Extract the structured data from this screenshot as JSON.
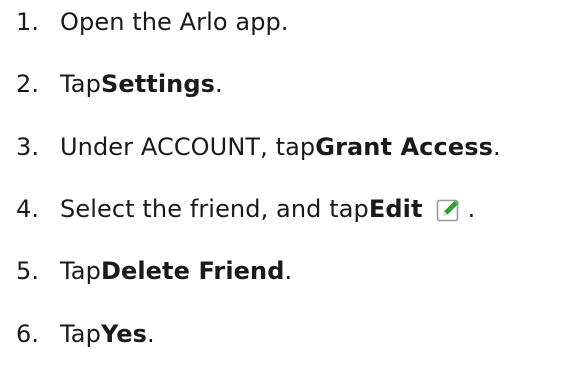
{
  "steps": [
    {
      "number": "1.",
      "pre": "Open the Arlo app.",
      "bold": "",
      "post": ""
    },
    {
      "number": "2.",
      "pre": "Tap ",
      "bold": "Settings",
      "post": "."
    },
    {
      "number": "3.",
      "pre": "Under ACCOUNT, tap ",
      "bold": "Grant Access",
      "post": "."
    },
    {
      "number": "4.",
      "pre": "Select the friend, and tap ",
      "bold": "Edit",
      "post": "."
    },
    {
      "number": "5.",
      "pre": "Tap ",
      "bold": "Delete Friend",
      "post": "."
    },
    {
      "number": "6.",
      "pre": "Tap ",
      "bold": "Yes",
      "post": "."
    }
  ],
  "icons": {
    "edit": "edit-pencil-icon"
  },
  "colors": {
    "text": "#1a1a1a",
    "icon_border": "#9a9a9a",
    "icon_pencil": "#2e9e3e"
  }
}
